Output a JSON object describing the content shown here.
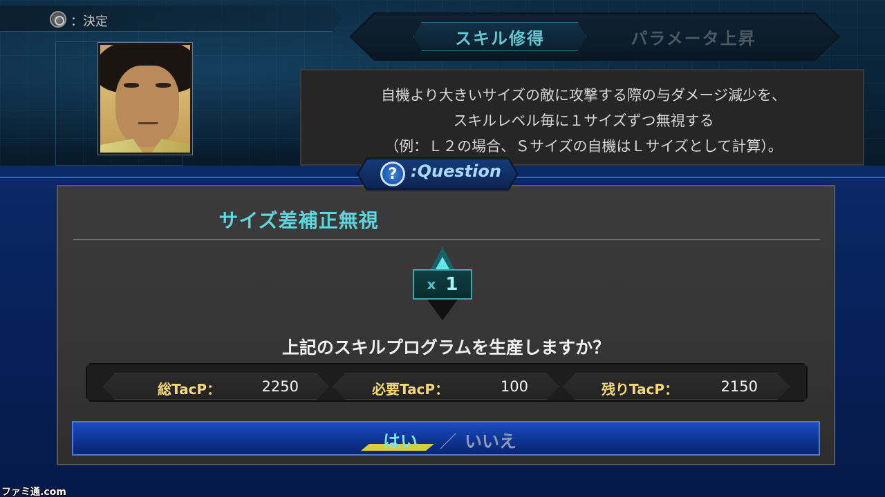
{
  "hint": {
    "button_label": "：決定"
  },
  "tabs": [
    {
      "label": "スキル修得",
      "active": true
    },
    {
      "label": "パラメータ上昇",
      "active": false
    }
  ],
  "description": [
    "自機より大きいサイズの敵に攻撃する際の与ダメージ減少を、",
    "スキルレベル毎に１サイズずつ無視する",
    "（例：Ｌ２の場合、Ｓサイズの自機はＬサイズとして計算）。"
  ],
  "dialog": {
    "header_label": ":Question",
    "header_icon": "?",
    "skill_name": "サイズ差補正無視",
    "level_prefix": "x",
    "level_value": "1",
    "question": "上記のスキルプログラムを生産しますか？",
    "points": [
      {
        "label": "総TacP：",
        "value": "2250"
      },
      {
        "label": "必要TacP：",
        "value": "100"
      },
      {
        "label": "残りTacP：",
        "value": "2150"
      }
    ],
    "yes_label": "はい",
    "separator": "／",
    "no_label": "いいえ",
    "selected": "yes"
  },
  "watermark": "ファミ通.com",
  "colors": {
    "accent_cyan": "#5ed6dc",
    "points_label": "#f2d878",
    "selection_underline": "#d8cc40",
    "answer_bar": "#0f3494"
  }
}
